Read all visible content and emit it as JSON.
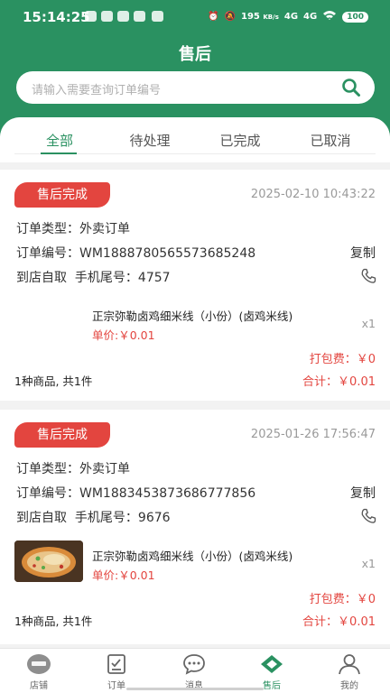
{
  "status_bar": {
    "time": "15:14:25",
    "speed": "195",
    "speed_unit": "KB/s",
    "net1": "4G",
    "net2": "4G",
    "battery": "100"
  },
  "header": {
    "title": "售后"
  },
  "search": {
    "placeholder": "请输入需要查询订单编号"
  },
  "tabs": [
    {
      "label": "全部",
      "active": true
    },
    {
      "label": "待处理",
      "active": false
    },
    {
      "label": "已完成",
      "active": false
    },
    {
      "label": "已取消",
      "active": false
    }
  ],
  "orders": [
    {
      "status": "售后完成",
      "date": "2025-02-10 10:43:22",
      "type_label": "订单类型：外卖订单",
      "number_label": "订单编号：WM1888780565573685248",
      "copy_label": "复制",
      "pickup_label": "到店自取",
      "phone_label": "手机尾号：4757",
      "product_name": "正宗弥勒卤鸡细米线（小份）(卤鸡米线)",
      "unit_price": "单价:￥0.01",
      "qty": "x1",
      "packing_fee": "打包费：￥0",
      "count": "1种商品, 共1件",
      "total": "合计：￥0.01",
      "has_image": false
    },
    {
      "status": "售后完成",
      "date": "2025-01-26 17:56:47",
      "type_label": "订单类型：外卖订单",
      "number_label": "订单编号：WM1883453873686777856",
      "copy_label": "复制",
      "pickup_label": "到店自取",
      "phone_label": "手机尾号：9676",
      "product_name": "正宗弥勒卤鸡细米线（小份）(卤鸡米线)",
      "unit_price": "单价:￥0.01",
      "qty": "x1",
      "packing_fee": "打包费：￥0",
      "count": "1种商品, 共1件",
      "total": "合计：￥0.01",
      "has_image": true
    }
  ],
  "bottom_nav": [
    {
      "label": "店铺",
      "icon": "store-logo-icon",
      "active": false
    },
    {
      "label": "订单",
      "icon": "order-icon",
      "active": false
    },
    {
      "label": "消息",
      "icon": "message-icon",
      "active": false
    },
    {
      "label": "售后",
      "icon": "aftersale-icon",
      "active": true
    },
    {
      "label": "我的",
      "icon": "profile-icon",
      "active": false
    }
  ],
  "colors": {
    "primary": "#2a9161",
    "accent_red": "#e3453f",
    "background": "#f2f2f2"
  }
}
